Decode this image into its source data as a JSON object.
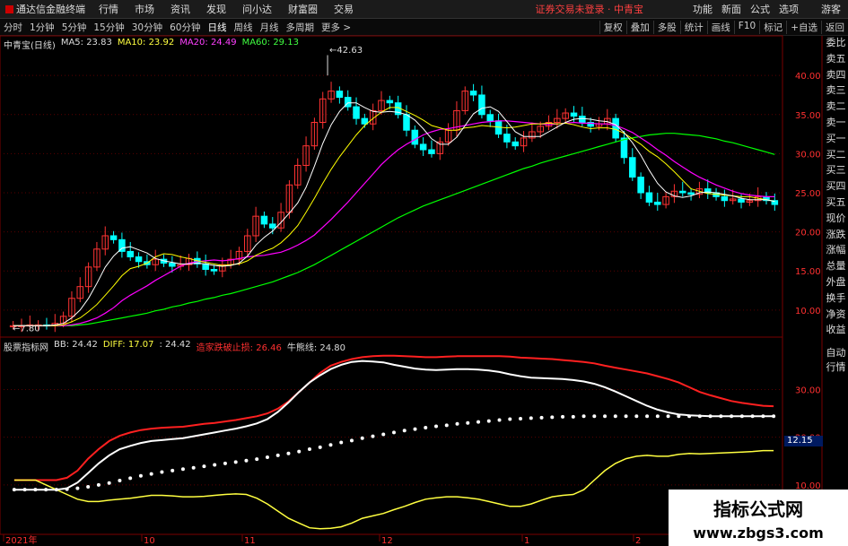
{
  "menubar": {
    "app_title": "通达信金融终端",
    "menus": [
      "行情",
      "市场",
      "资讯",
      "发现",
      "问小达",
      "财富圈",
      "交易"
    ],
    "status": "证券交易未登录 · 中青宝",
    "right_menus": [
      "功能",
      "新面",
      "公式",
      "选项"
    ],
    "guest": "游客"
  },
  "toolbar": {
    "timeframes": [
      "分时",
      "1分钟",
      "5分钟",
      "15分钟",
      "30分钟",
      "60分钟",
      "日线",
      "周线",
      "月线",
      "多周期",
      "更多 >"
    ],
    "selected": "日线",
    "right_buttons": [
      "复权",
      "叠加",
      "多股",
      "统计",
      "画线",
      "F10",
      "标记",
      "+自选",
      "返回"
    ]
  },
  "main_header": {
    "stock": "中青宝(日线)",
    "ma5": "MA5: 23.83",
    "ma10": "MA10: 23.92",
    "ma20": "MA20: 24.49",
    "ma60": "MA60: 29.13"
  },
  "sub_header": {
    "indicator": "股票指标网",
    "bb": "BB: 24.42",
    "diff": "DIFF: 17.07",
    "val": ": 24.42",
    "stop": "造家跌破止损: 26.46",
    "bull": "牛熊线: 24.80"
  },
  "sidebar": [
    "委比",
    "卖五",
    "卖四",
    "卖三",
    "卖二",
    "卖一",
    "买一",
    "买二",
    "买三",
    "买四",
    "买五",
    "现价",
    "涨跌",
    "涨幅",
    "总量",
    "外盘",
    "换手",
    "净资",
    "收益"
  ],
  "sidebar2": [
    "自动",
    "行情"
  ],
  "price_axis": [
    "40.00",
    "35.00",
    "30.00",
    "25.00",
    "20.00",
    "15.00",
    "10.00"
  ],
  "sub_axis": [
    "30.00",
    "20.00",
    "10.00"
  ],
  "x_labels": [
    "2021年",
    "10",
    "11",
    "12",
    "1",
    "2"
  ],
  "annotations": {
    "high": "42.63",
    "low": "7.80"
  },
  "current_value": "12.15",
  "watermark": {
    "line1": "指标公式网",
    "line2": "www.zbgs3.com"
  },
  "colors": {
    "up": "#ff3333",
    "down": "#00ffff",
    "ma5": "#ffffff",
    "ma10": "#ffff00",
    "ma20": "#ff00ff",
    "ma60": "#00ff00"
  },
  "chart_data": {
    "type": "candlestick",
    "ylim": [
      7,
      43
    ],
    "sub_ylim": [
      0,
      38
    ],
    "close": [
      8.0,
      8.0,
      8.1,
      8.1,
      8.0,
      8.3,
      9.2,
      11.5,
      13.0,
      15.5,
      17.8,
      19.5,
      19.0,
      17.5,
      16.8,
      16.2,
      15.8,
      16.5,
      16.0,
      15.6,
      15.8,
      16.6,
      15.9,
      15.2,
      15.0,
      15.8,
      16.5,
      17.5,
      19.5,
      22.0,
      21.0,
      20.5,
      22.5,
      26.0,
      28.5,
      31.0,
      34.0,
      37.0,
      38.0,
      37.2,
      36.0,
      34.5,
      33.8,
      35.5,
      36.8,
      36.5,
      35.0,
      33.0,
      31.2,
      30.5,
      30.0,
      31.5,
      33.0,
      35.5,
      38.0,
      37.5,
      35.0,
      34.2,
      32.5,
      31.5,
      31.0,
      32.0,
      32.8,
      33.5,
      34.0,
      34.5,
      35.2,
      34.8,
      34.0,
      33.5,
      33.8,
      34.5,
      32.0,
      29.5,
      27.0,
      25.0,
      23.8,
      23.5,
      24.5,
      25.2,
      25.0,
      24.8,
      25.5,
      25.0,
      24.5,
      24.0,
      24.2,
      23.8,
      24.0,
      24.5,
      24.0,
      23.5
    ],
    "ma5": [
      8,
      8,
      8,
      8,
      8,
      8.1,
      8.3,
      9,
      10,
      11.5,
      13.4,
      15.5,
      16.9,
      17.9,
      18.1,
      17.7,
      17.3,
      16.6,
      16.3,
      16.1,
      15.9,
      15.9,
      16,
      15.9,
      15.7,
      15.6,
      15.7,
      16,
      16.9,
      18.3,
      19.3,
      20.1,
      21.2,
      22.4,
      23.7,
      25.7,
      28.4,
      31.3,
      33.7,
      35.4,
      36.5,
      36.5,
      35.9,
      35.4,
      35.3,
      35.4,
      35.3,
      35,
      34.3,
      33.2,
      31.9,
      31.2,
      31.2,
      32.1,
      33.6,
      35.1,
      35.8,
      36,
      35.4,
      34.1,
      32.8,
      32.2,
      32.2,
      32.2,
      32.8,
      33.4,
      34,
      34.4,
      34.5,
      34.4,
      34.2,
      34.1,
      33.7,
      32.7,
      31.4,
      29.8,
      27.9,
      26.2,
      25.1,
      24.6,
      24.4,
      24.6,
      25,
      25.1,
      25,
      24.8,
      24.6,
      24.3,
      24.1,
      24.1,
      24.1,
      23.9
    ],
    "ma10": [
      8,
      8,
      8,
      8,
      8,
      8,
      8.1,
      8.5,
      9,
      9.8,
      10.7,
      11.9,
      13.1,
      14.4,
      15.3,
      15.6,
      16,
      16.8,
      17.2,
      17.1,
      16.8,
      16.6,
      16.3,
      16.1,
      15.9,
      15.7,
      15.8,
      15.9,
      16.3,
      17,
      17.5,
      17.9,
      18.6,
      19.6,
      20.8,
      22.5,
      24.3,
      26.2,
      28,
      29.6,
      31,
      32.4,
      33.6,
      34.5,
      35.3,
      35.9,
      35.9,
      35.4,
      34.9,
      34.3,
      33.6,
      33.3,
      33,
      33,
      33.3,
      33.4,
      33.6,
      33.5,
      33.4,
      33.3,
      33.4,
      33.6,
      33.8,
      33.8,
      33.9,
      33.8,
      33.9,
      33.7,
      33.4,
      33.2,
      33.3,
      33.3,
      33.1,
      32.6,
      31.9,
      31.2,
      30.3,
      29.6,
      28.7,
      27.7,
      26.6,
      25.5,
      25.2,
      24.9,
      24.8,
      24.7,
      24.6,
      24.5,
      24.5,
      24.3,
      24.1,
      23.9
    ],
    "ma20": [
      8,
      8,
      8,
      8,
      8,
      8,
      8,
      8.1,
      8.3,
      8.6,
      9,
      9.6,
      10.3,
      11.2,
      11.9,
      12.5,
      13.1,
      13.8,
      14.4,
      15,
      15.6,
      16,
      16.2,
      16.3,
      16.4,
      16.3,
      16.4,
      16.6,
      16.8,
      16.9,
      17,
      17.2,
      17.4,
      17.8,
      18.3,
      18.9,
      19.6,
      20.6,
      21.6,
      22.7,
      23.8,
      25,
      26.2,
      27.4,
      28.6,
      29.6,
      30.5,
      31.2,
      31.8,
      32.4,
      32.8,
      33.1,
      33.2,
      33.4,
      33.6,
      33.8,
      34,
      34.1,
      34.2,
      34.2,
      34.1,
      34,
      33.9,
      33.8,
      33.7,
      33.8,
      33.9,
      34,
      33.9,
      33.9,
      33.8,
      33.8,
      33.6,
      33.2,
      32.7,
      32,
      31.3,
      30.5,
      29.8,
      29,
      28.3,
      27.6,
      27,
      26.5,
      26,
      25.6,
      25.2,
      24.9,
      24.7,
      24.6,
      24.5,
      24.5
    ],
    "ma60": [
      8,
      8,
      8,
      8,
      8,
      8,
      8,
      8,
      8.1,
      8.2,
      8.4,
      8.6,
      8.8,
      9,
      9.2,
      9.4,
      9.6,
      9.9,
      10.1,
      10.4,
      10.6,
      10.9,
      11.1,
      11.4,
      11.6,
      11.9,
      12.1,
      12.4,
      12.7,
      13,
      13.3,
      13.6,
      14,
      14.4,
      14.8,
      15.3,
      15.8,
      16.4,
      17,
      17.6,
      18.2,
      18.8,
      19.4,
      20,
      20.6,
      21.2,
      21.8,
      22.3,
      22.8,
      23.3,
      23.7,
      24.1,
      24.5,
      24.9,
      25.3,
      25.7,
      26.1,
      26.5,
      26.9,
      27.3,
      27.7,
      28.1,
      28.4,
      28.8,
      29.1,
      29.4,
      29.7,
      30,
      30.3,
      30.6,
      30.9,
      31.2,
      31.5,
      31.8,
      32,
      32.2,
      32.4,
      32.5,
      32.6,
      32.6,
      32.5,
      32.4,
      32.3,
      32.1,
      31.9,
      31.6,
      31.4,
      31.1,
      30.8,
      30.5,
      30.2,
      29.9
    ],
    "red": [
      11,
      11,
      11,
      11,
      11,
      11.5,
      13,
      15.5,
      17.5,
      19.2,
      20.3,
      21,
      21.5,
      21.8,
      22,
      22.1,
      22.2,
      22.5,
      22.8,
      23,
      23.3,
      23.6,
      24,
      24.4,
      25,
      26,
      27.5,
      29.5,
      31.5,
      33.5,
      35,
      35.8,
      36.4,
      36.8,
      37,
      37.1,
      37.1,
      37,
      36.9,
      36.8,
      36.8,
      36.9,
      37,
      37,
      37,
      37,
      37,
      36.9,
      36.7,
      36.6,
      36.5,
      36.4,
      36.2,
      36,
      35.8,
      35.5,
      35,
      34.6,
      34.2,
      33.8,
      33.4,
      32.8,
      32.2,
      31.5,
      30.5,
      29.5,
      28.8,
      28.2,
      27.6,
      27.2,
      26.9,
      26.6,
      26.5
    ],
    "white": [
      9,
      9,
      9,
      9,
      9,
      9.3,
      10.5,
      12.5,
      14.5,
      16.2,
      17.5,
      18.2,
      18.8,
      19.2,
      19.4,
      19.6,
      19.8,
      20.2,
      20.6,
      21,
      21.4,
      21.8,
      22.3,
      22.9,
      23.8,
      25.3,
      27.3,
      29.5,
      31.5,
      33,
      34.3,
      35.2,
      35.8,
      36,
      35.9,
      35.7,
      35.2,
      34.8,
      34.4,
      34.2,
      34.1,
      34.2,
      34.3,
      34.3,
      34.2,
      34,
      33.7,
      33.2,
      32.8,
      32.5,
      32.4,
      32.3,
      32.2,
      32,
      31.7,
      31.2,
      30.5,
      29.6,
      28.6,
      27.6,
      26.6,
      25.8,
      25.2,
      24.8,
      24.6,
      24.5,
      24.4,
      24.4,
      24.4,
      24.4,
      24.4,
      24.4,
      24.4
    ],
    "dots": [
      9,
      9,
      9,
      9,
      9,
      9.1,
      9.3,
      9.6,
      10,
      10.4,
      10.9,
      11.4,
      11.9,
      12.3,
      12.7,
      13,
      13.3,
      13.6,
      13.9,
      14.2,
      14.5,
      14.8,
      15.1,
      15.4,
      15.8,
      16.2,
      16.6,
      17,
      17.5,
      17.9,
      18.4,
      18.9,
      19.3,
      19.8,
      20.2,
      20.6,
      21,
      21.4,
      21.7,
      22,
      22.3,
      22.5,
      22.8,
      23,
      23.2,
      23.4,
      23.6,
      23.8,
      23.9,
      24,
      24.1,
      24.2,
      24.3,
      24.3,
      24.4,
      24.4,
      24.4,
      24.4,
      24.4,
      24.4,
      24.4,
      24.4,
      24.4,
      24.4,
      24.4,
      24.4,
      24.4,
      24.4,
      24.4,
      24.4,
      24.4,
      24.4,
      24.4
    ],
    "yellow": [
      11,
      11,
      11,
      10,
      9,
      8,
      7,
      6.5,
      6.5,
      6.8,
      7,
      7.2,
      7.5,
      7.8,
      7.8,
      7.7,
      7.5,
      7.5,
      7.6,
      7.8,
      8,
      8.1,
      8,
      7.2,
      6,
      4.5,
      3,
      2,
      1,
      0.8,
      0.9,
      1.2,
      2,
      3,
      3.5,
      4,
      4.8,
      5.5,
      6.3,
      7,
      7.3,
      7.5,
      7.5,
      7.3,
      7,
      6.5,
      6,
      5.5,
      5.5,
      6,
      6.8,
      7.5,
      7.8,
      8,
      9,
      11,
      13,
      14.5,
      15.5,
      16,
      16.2,
      16,
      16,
      16.4,
      16.6,
      16.5,
      16.6,
      16.7,
      16.8,
      16.9,
      17,
      17.2,
      17.2
    ]
  }
}
